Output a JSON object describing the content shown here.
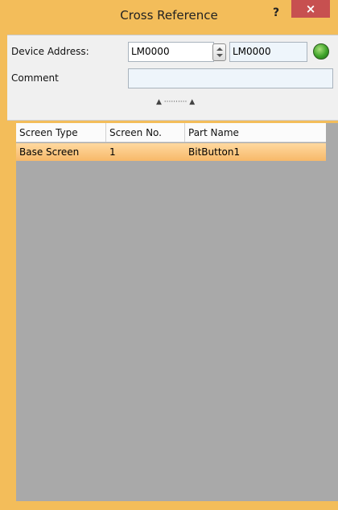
{
  "window": {
    "title": "Cross Reference",
    "help_label": "?",
    "close_label": "×"
  },
  "form": {
    "device_address_label": "Device Address:",
    "device_address_from": "LM0000",
    "device_address_to": "LM0000",
    "comment_label": "Comment",
    "comment_value": ""
  },
  "splitter": {
    "grip": "▲ ·········· ▲"
  },
  "table": {
    "columns": [
      "Screen Type",
      "Screen No.",
      "Part Name"
    ],
    "rows": [
      {
        "screen_type": "Base Screen",
        "screen_no": "1",
        "part_name": "BitButton1"
      }
    ]
  },
  "colors": {
    "frame": "#f3bd5a",
    "selected_row": "#f7b969",
    "grid_bg": "#a9a9a9",
    "close_button": "#c75050"
  },
  "icons": {
    "go_button": "green-circle-icon",
    "spin": "spin-arrows-icon"
  }
}
